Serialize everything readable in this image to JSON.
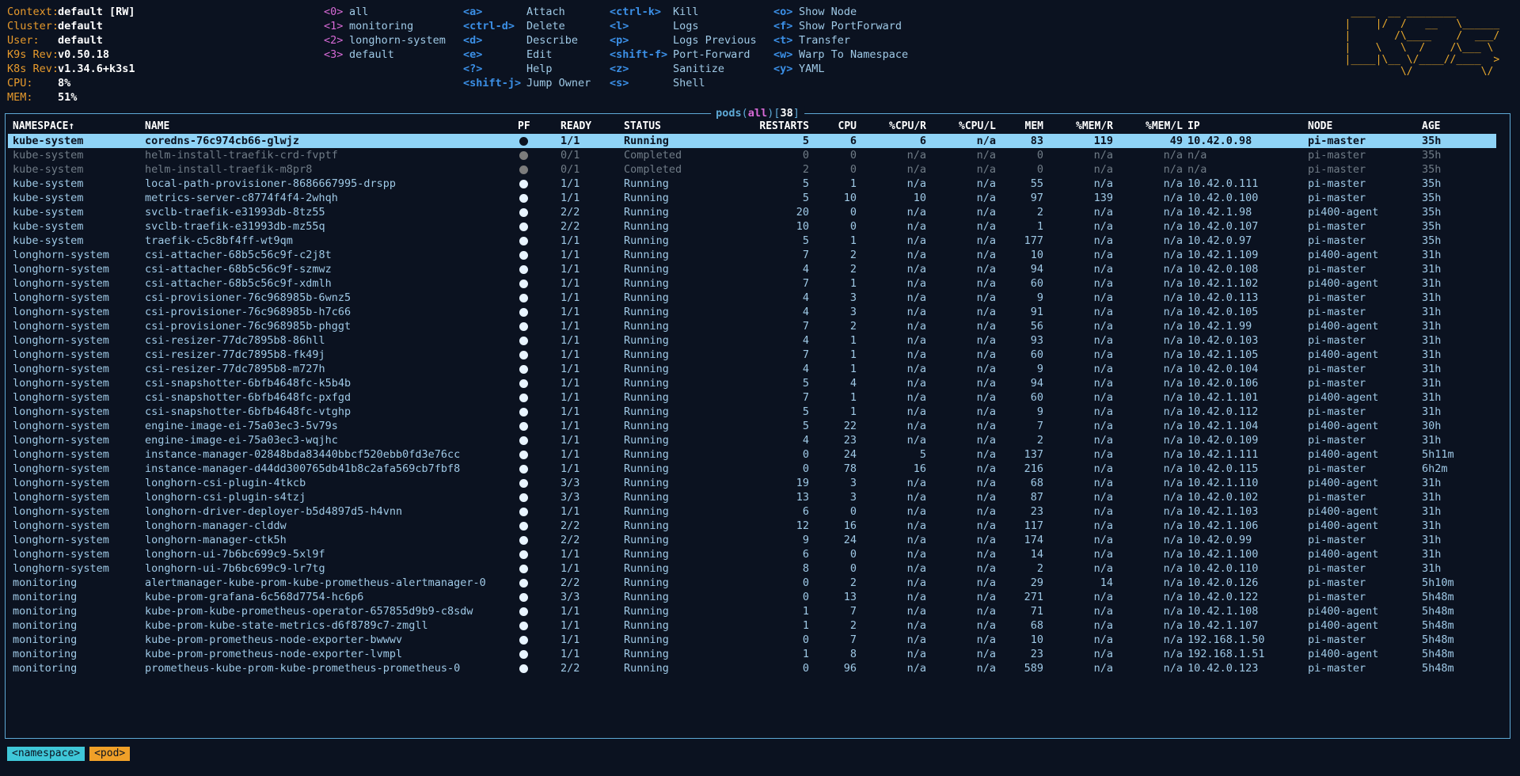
{
  "info": [
    {
      "key": "Context:",
      "value": "default [RW]"
    },
    {
      "key": "Cluster:",
      "value": "default"
    },
    {
      "key": "User:",
      "value": "default"
    },
    {
      "key": "K9s Rev:",
      "value": "v0.50.18"
    },
    {
      "key": "K8s Rev:",
      "value": "v1.34.6+k3s1"
    },
    {
      "key": "CPU:",
      "value": "8%"
    },
    {
      "key": "MEM:",
      "value": "51%"
    }
  ],
  "namespaces": [
    {
      "key": "<0>",
      "label": "all"
    },
    {
      "key": "<1>",
      "label": "monitoring"
    },
    {
      "key": "<2>",
      "label": "longhorn-system"
    },
    {
      "key": "<3>",
      "label": "default"
    }
  ],
  "hotkeys_col1": [
    {
      "key": "<a>",
      "label": "Attach"
    },
    {
      "key": "<ctrl-d>",
      "label": "Delete"
    },
    {
      "key": "<d>",
      "label": "Describe"
    },
    {
      "key": "<e>",
      "label": "Edit"
    },
    {
      "key": "<?>",
      "label": "Help"
    },
    {
      "key": "<shift-j>",
      "label": "Jump Owner"
    }
  ],
  "hotkeys_col2": [
    {
      "key": "<ctrl-k>",
      "label": "Kill"
    },
    {
      "key": "<l>",
      "label": "Logs"
    },
    {
      "key": "<p>",
      "label": "Logs Previous"
    },
    {
      "key": "<shift-f>",
      "label": "Port-Forward"
    },
    {
      "key": "<z>",
      "label": "Sanitize"
    },
    {
      "key": "<s>",
      "label": "Shell"
    }
  ],
  "hotkeys_col3": [
    {
      "key": "<o>",
      "label": "Show Node"
    },
    {
      "key": "<f>",
      "label": "Show PortForward"
    },
    {
      "key": "<t>",
      "label": "Transfer"
    },
    {
      "key": "<w>",
      "label": "Warp To Namespace"
    },
    {
      "key": "<y>",
      "label": "YAML"
    }
  ],
  "logo": " ____  __ ________        \n|    |/  /   __   \\______ \n|       /\\____    /  ___/ \n|    \\   \\  /    /\\___ \\  \n|____|\\__ \\/____//____  > \n         \\/           \\/  ",
  "frame": {
    "title": "pods",
    "filter": "all",
    "count": "38"
  },
  "columns": [
    "NAMESPACE↑",
    "NAME",
    "PF",
    "READY",
    "STATUS",
    "RESTARTS",
    "CPU",
    "%CPU/R",
    "%CPU/L",
    "MEM",
    "%MEM/R",
    "%MEM/L",
    "IP",
    "NODE",
    "AGE"
  ],
  "pods": [
    [
      "kube-system",
      "coredns-76c974cb66-glwjz",
      "●",
      "1/1",
      "Running",
      "5",
      "6",
      "6",
      "n/a",
      "83",
      "119",
      "49",
      "10.42.0.98",
      "pi-master",
      "35h"
    ],
    [
      "kube-system",
      "helm-install-traefik-crd-fvptf",
      "●",
      "0/1",
      "Completed",
      "0",
      "0",
      "n/a",
      "n/a",
      "0",
      "n/a",
      "n/a",
      "n/a",
      "pi-master",
      "35h"
    ],
    [
      "kube-system",
      "helm-install-traefik-m8pr8",
      "●",
      "0/1",
      "Completed",
      "2",
      "0",
      "n/a",
      "n/a",
      "0",
      "n/a",
      "n/a",
      "n/a",
      "pi-master",
      "35h"
    ],
    [
      "kube-system",
      "local-path-provisioner-8686667995-drspp",
      "●",
      "1/1",
      "Running",
      "5",
      "1",
      "n/a",
      "n/a",
      "55",
      "n/a",
      "n/a",
      "10.42.0.111",
      "pi-master",
      "35h"
    ],
    [
      "kube-system",
      "metrics-server-c8774f4f4-2whqh",
      "●",
      "1/1",
      "Running",
      "5",
      "10",
      "10",
      "n/a",
      "97",
      "139",
      "n/a",
      "10.42.0.100",
      "pi-master",
      "35h"
    ],
    [
      "kube-system",
      "svclb-traefik-e31993db-8tz55",
      "●",
      "2/2",
      "Running",
      "20",
      "0",
      "n/a",
      "n/a",
      "2",
      "n/a",
      "n/a",
      "10.42.1.98",
      "pi400-agent",
      "35h"
    ],
    [
      "kube-system",
      "svclb-traefik-e31993db-mz55q",
      "●",
      "2/2",
      "Running",
      "10",
      "0",
      "n/a",
      "n/a",
      "1",
      "n/a",
      "n/a",
      "10.42.0.107",
      "pi-master",
      "35h"
    ],
    [
      "kube-system",
      "traefik-c5c8bf4ff-wt9qm",
      "●",
      "1/1",
      "Running",
      "5",
      "1",
      "n/a",
      "n/a",
      "177",
      "n/a",
      "n/a",
      "10.42.0.97",
      "pi-master",
      "35h"
    ],
    [
      "longhorn-system",
      "csi-attacher-68b5c56c9f-c2j8t",
      "●",
      "1/1",
      "Running",
      "7",
      "2",
      "n/a",
      "n/a",
      "10",
      "n/a",
      "n/a",
      "10.42.1.109",
      "pi400-agent",
      "31h"
    ],
    [
      "longhorn-system",
      "csi-attacher-68b5c56c9f-szmwz",
      "●",
      "1/1",
      "Running",
      "4",
      "2",
      "n/a",
      "n/a",
      "94",
      "n/a",
      "n/a",
      "10.42.0.108",
      "pi-master",
      "31h"
    ],
    [
      "longhorn-system",
      "csi-attacher-68b5c56c9f-xdmlh",
      "●",
      "1/1",
      "Running",
      "7",
      "1",
      "n/a",
      "n/a",
      "60",
      "n/a",
      "n/a",
      "10.42.1.102",
      "pi400-agent",
      "31h"
    ],
    [
      "longhorn-system",
      "csi-provisioner-76c968985b-6wnz5",
      "●",
      "1/1",
      "Running",
      "4",
      "3",
      "n/a",
      "n/a",
      "9",
      "n/a",
      "n/a",
      "10.42.0.113",
      "pi-master",
      "31h"
    ],
    [
      "longhorn-system",
      "csi-provisioner-76c968985b-h7c66",
      "●",
      "1/1",
      "Running",
      "4",
      "3",
      "n/a",
      "n/a",
      "91",
      "n/a",
      "n/a",
      "10.42.0.105",
      "pi-master",
      "31h"
    ],
    [
      "longhorn-system",
      "csi-provisioner-76c968985b-phggt",
      "●",
      "1/1",
      "Running",
      "7",
      "2",
      "n/a",
      "n/a",
      "56",
      "n/a",
      "n/a",
      "10.42.1.99",
      "pi400-agent",
      "31h"
    ],
    [
      "longhorn-system",
      "csi-resizer-77dc7895b8-86hll",
      "●",
      "1/1",
      "Running",
      "4",
      "1",
      "n/a",
      "n/a",
      "93",
      "n/a",
      "n/a",
      "10.42.0.103",
      "pi-master",
      "31h"
    ],
    [
      "longhorn-system",
      "csi-resizer-77dc7895b8-fk49j",
      "●",
      "1/1",
      "Running",
      "7",
      "1",
      "n/a",
      "n/a",
      "60",
      "n/a",
      "n/a",
      "10.42.1.105",
      "pi400-agent",
      "31h"
    ],
    [
      "longhorn-system",
      "csi-resizer-77dc7895b8-m727h",
      "●",
      "1/1",
      "Running",
      "4",
      "1",
      "n/a",
      "n/a",
      "9",
      "n/a",
      "n/a",
      "10.42.0.104",
      "pi-master",
      "31h"
    ],
    [
      "longhorn-system",
      "csi-snapshotter-6bfb4648fc-k5b4b",
      "●",
      "1/1",
      "Running",
      "5",
      "4",
      "n/a",
      "n/a",
      "94",
      "n/a",
      "n/a",
      "10.42.0.106",
      "pi-master",
      "31h"
    ],
    [
      "longhorn-system",
      "csi-snapshotter-6bfb4648fc-pxfgd",
      "●",
      "1/1",
      "Running",
      "7",
      "1",
      "n/a",
      "n/a",
      "60",
      "n/a",
      "n/a",
      "10.42.1.101",
      "pi400-agent",
      "31h"
    ],
    [
      "longhorn-system",
      "csi-snapshotter-6bfb4648fc-vtghp",
      "●",
      "1/1",
      "Running",
      "5",
      "1",
      "n/a",
      "n/a",
      "9",
      "n/a",
      "n/a",
      "10.42.0.112",
      "pi-master",
      "31h"
    ],
    [
      "longhorn-system",
      "engine-image-ei-75a03ec3-5v79s",
      "●",
      "1/1",
      "Running",
      "5",
      "22",
      "n/a",
      "n/a",
      "7",
      "n/a",
      "n/a",
      "10.42.1.104",
      "pi400-agent",
      "30h"
    ],
    [
      "longhorn-system",
      "engine-image-ei-75a03ec3-wqjhc",
      "●",
      "1/1",
      "Running",
      "4",
      "23",
      "n/a",
      "n/a",
      "2",
      "n/a",
      "n/a",
      "10.42.0.109",
      "pi-master",
      "31h"
    ],
    [
      "longhorn-system",
      "instance-manager-02848bda83440bbcf520ebb0fd3e76cc",
      "●",
      "1/1",
      "Running",
      "0",
      "24",
      "5",
      "n/a",
      "137",
      "n/a",
      "n/a",
      "10.42.1.111",
      "pi400-agent",
      "5h11m"
    ],
    [
      "longhorn-system",
      "instance-manager-d44dd300765db41b8c2afa569cb7fbf8",
      "●",
      "1/1",
      "Running",
      "0",
      "78",
      "16",
      "n/a",
      "216",
      "n/a",
      "n/a",
      "10.42.0.115",
      "pi-master",
      "6h2m"
    ],
    [
      "longhorn-system",
      "longhorn-csi-plugin-4tkcb",
      "●",
      "3/3",
      "Running",
      "19",
      "3",
      "n/a",
      "n/a",
      "68",
      "n/a",
      "n/a",
      "10.42.1.110",
      "pi400-agent",
      "31h"
    ],
    [
      "longhorn-system",
      "longhorn-csi-plugin-s4tzj",
      "●",
      "3/3",
      "Running",
      "13",
      "3",
      "n/a",
      "n/a",
      "87",
      "n/a",
      "n/a",
      "10.42.0.102",
      "pi-master",
      "31h"
    ],
    [
      "longhorn-system",
      "longhorn-driver-deployer-b5d4897d5-h4vnn",
      "●",
      "1/1",
      "Running",
      "6",
      "0",
      "n/a",
      "n/a",
      "23",
      "n/a",
      "n/a",
      "10.42.1.103",
      "pi400-agent",
      "31h"
    ],
    [
      "longhorn-system",
      "longhorn-manager-clddw",
      "●",
      "2/2",
      "Running",
      "12",
      "16",
      "n/a",
      "n/a",
      "117",
      "n/a",
      "n/a",
      "10.42.1.106",
      "pi400-agent",
      "31h"
    ],
    [
      "longhorn-system",
      "longhorn-manager-ctk5h",
      "●",
      "2/2",
      "Running",
      "9",
      "24",
      "n/a",
      "n/a",
      "174",
      "n/a",
      "n/a",
      "10.42.0.99",
      "pi-master",
      "31h"
    ],
    [
      "longhorn-system",
      "longhorn-ui-7b6bc699c9-5xl9f",
      "●",
      "1/1",
      "Running",
      "6",
      "0",
      "n/a",
      "n/a",
      "14",
      "n/a",
      "n/a",
      "10.42.1.100",
      "pi400-agent",
      "31h"
    ],
    [
      "longhorn-system",
      "longhorn-ui-7b6bc699c9-lr7tg",
      "●",
      "1/1",
      "Running",
      "8",
      "0",
      "n/a",
      "n/a",
      "2",
      "n/a",
      "n/a",
      "10.42.0.110",
      "pi-master",
      "31h"
    ],
    [
      "monitoring",
      "alertmanager-kube-prom-kube-prometheus-alertmanager-0",
      "●",
      "2/2",
      "Running",
      "0",
      "2",
      "n/a",
      "n/a",
      "29",
      "14",
      "n/a",
      "10.42.0.126",
      "pi-master",
      "5h10m"
    ],
    [
      "monitoring",
      "kube-prom-grafana-6c568d7754-hc6p6",
      "●",
      "3/3",
      "Running",
      "0",
      "13",
      "n/a",
      "n/a",
      "271",
      "n/a",
      "n/a",
      "10.42.0.122",
      "pi-master",
      "5h48m"
    ],
    [
      "monitoring",
      "kube-prom-kube-prometheus-operator-657855d9b9-c8sdw",
      "●",
      "1/1",
      "Running",
      "1",
      "7",
      "n/a",
      "n/a",
      "71",
      "n/a",
      "n/a",
      "10.42.1.108",
      "pi400-agent",
      "5h48m"
    ],
    [
      "monitoring",
      "kube-prom-kube-state-metrics-d6f8789c7-zmgll",
      "●",
      "1/1",
      "Running",
      "1",
      "2",
      "n/a",
      "n/a",
      "68",
      "n/a",
      "n/a",
      "10.42.1.107",
      "pi400-agent",
      "5h48m"
    ],
    [
      "monitoring",
      "kube-prom-prometheus-node-exporter-bwwwv",
      "●",
      "1/1",
      "Running",
      "0",
      "7",
      "n/a",
      "n/a",
      "10",
      "n/a",
      "n/a",
      "192.168.1.50",
      "pi-master",
      "5h48m"
    ],
    [
      "monitoring",
      "kube-prom-prometheus-node-exporter-lvmpl",
      "●",
      "1/1",
      "Running",
      "1",
      "8",
      "n/a",
      "n/a",
      "23",
      "n/a",
      "n/a",
      "192.168.1.51",
      "pi400-agent",
      "5h48m"
    ],
    [
      "monitoring",
      "prometheus-kube-prom-kube-prometheus-prometheus-0",
      "●",
      "2/2",
      "Running",
      "0",
      "96",
      "n/a",
      "n/a",
      "589",
      "n/a",
      "n/a",
      "10.42.0.123",
      "pi-master",
      "5h48m"
    ]
  ],
  "breadcrumbs": [
    "<namespace>",
    "<pod>"
  ]
}
